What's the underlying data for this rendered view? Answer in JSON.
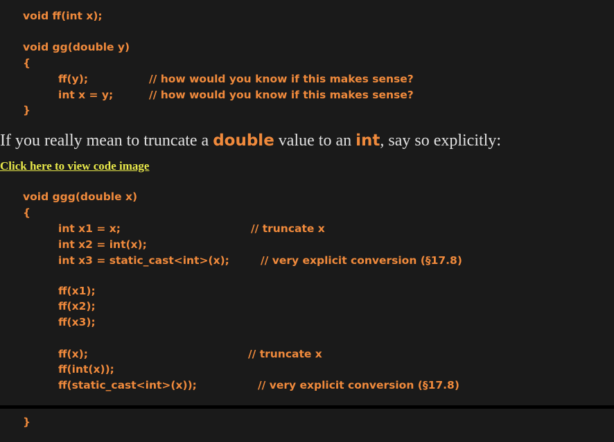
{
  "colors": {
    "background": "#1a1a1a",
    "code": "#f08a3c",
    "prose": "#e0e0e0",
    "link": "#e8e84a",
    "divider": "#000000"
  },
  "code_block_1": {
    "lines": [
      "void ff(int x);",
      "void gg(double y)",
      "{",
      "ff(y);",
      "int x = y;",
      "}"
    ],
    "comments": [
      "// how would you know if this makes sense?",
      "// how would you know if this makes sense?"
    ]
  },
  "prose": {
    "before_1": "If you really mean to truncate a ",
    "kw_1": "double",
    "between": " value to an ",
    "kw_2": "int",
    "after": ", say so explicitly:"
  },
  "link": {
    "label": "Click here to view code image"
  },
  "code_block_2": {
    "lines": [
      "void ggg(double x)",
      "{",
      "int x1 = x;",
      "int x2 = int(x);",
      "int x3 = static_cast<int>(x);",
      "ff(x1);",
      "ff(x2);",
      "ff(x3);",
      "ff(x);",
      "ff(int(x));",
      "ff(static_cast<int>(x));",
      "}"
    ],
    "comments": [
      "// truncate x",
      "// very explicit conversion (§17.8)",
      "// truncate x",
      "// very explicit conversion (§17.8)"
    ]
  }
}
